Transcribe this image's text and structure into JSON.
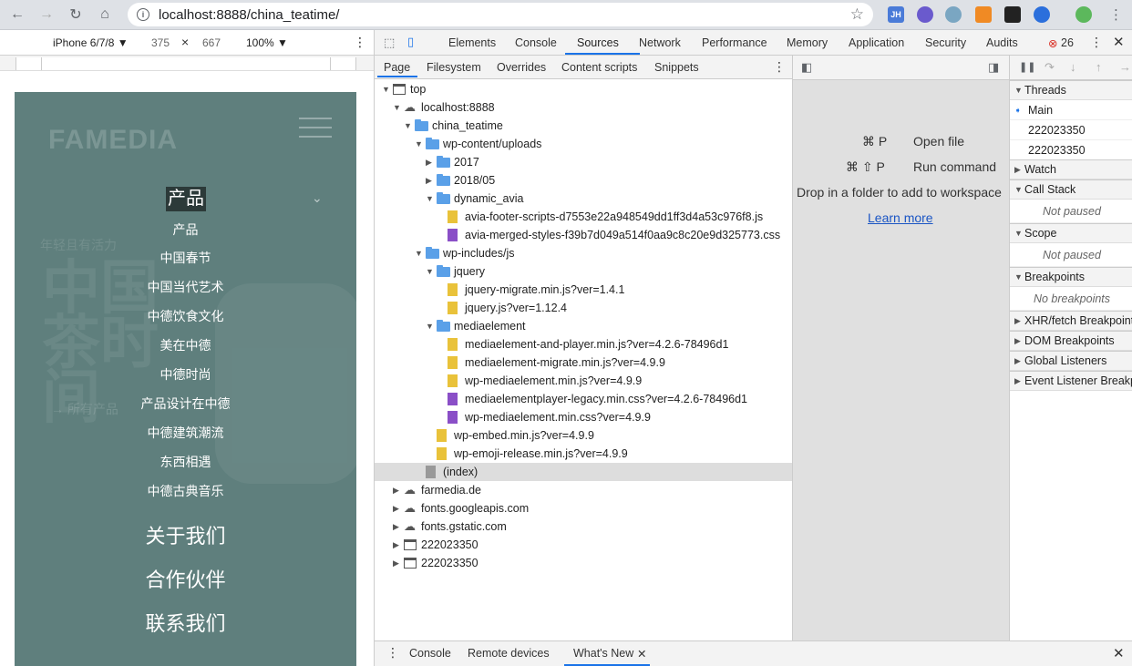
{
  "browser": {
    "url": "localhost:8888/china_teatime/",
    "ext_jh": "JH",
    "back_icon": "arrow-left-icon",
    "forward_icon": "arrow-right-icon",
    "reload_icon": "reload-icon",
    "home_icon": "home-icon"
  },
  "device": {
    "model": "iPhone 6/7/8 ▼",
    "width": "375",
    "times": "×",
    "height": "667",
    "zoom": "100% ▼"
  },
  "phone": {
    "logo": "FAMEDIA",
    "ghost_tagline": "年轻且有活力",
    "ghost_title": "中国茶时间",
    "ghost_link": "→ 所有产品",
    "menu_head": "产品",
    "menu_items": [
      "产品",
      "中国春节",
      "中国当代艺术",
      "中德饮食文化",
      "美在中德",
      "中德时尚",
      "产品设计在中德",
      "中德建筑潮流",
      "东西相遇",
      "中德古典音乐"
    ],
    "menu_big": [
      "关于我们",
      "合作伙伴",
      "联系我们"
    ]
  },
  "devtools": {
    "tabs": [
      "Elements",
      "Console",
      "Sources",
      "Network",
      "Performance",
      "Memory",
      "Application",
      "Security",
      "Audits"
    ],
    "error_count": "26",
    "sub_tabs": [
      "Page",
      "Filesystem",
      "Overrides",
      "Content scripts",
      "Snippets"
    ],
    "tree": [
      {
        "label": "top",
        "kind": "frame",
        "depth": 0,
        "open": true
      },
      {
        "label": "localhost:8888",
        "kind": "cloud",
        "depth": 1,
        "open": true
      },
      {
        "label": "china_teatime",
        "kind": "folder",
        "depth": 2,
        "open": true
      },
      {
        "label": "wp-content/uploads",
        "kind": "folder",
        "depth": 3,
        "open": true
      },
      {
        "label": "2017",
        "kind": "folder",
        "depth": 4,
        "open": false
      },
      {
        "label": "2018/05",
        "kind": "folder",
        "depth": 4,
        "open": false
      },
      {
        "label": "dynamic_avia",
        "kind": "folder",
        "depth": 4,
        "open": true
      },
      {
        "label": "avia-footer-scripts-d7553e22a948549dd1ff3d4a53c976f8.js",
        "kind": "js",
        "depth": 5
      },
      {
        "label": "avia-merged-styles-f39b7d049a514f0aa9c8c20e9d325773.css",
        "kind": "css",
        "depth": 5
      },
      {
        "label": "wp-includes/js",
        "kind": "folder",
        "depth": 3,
        "open": true
      },
      {
        "label": "jquery",
        "kind": "folder",
        "depth": 4,
        "open": true
      },
      {
        "label": "jquery-migrate.min.js?ver=1.4.1",
        "kind": "js",
        "depth": 5
      },
      {
        "label": "jquery.js?ver=1.12.4",
        "kind": "js",
        "depth": 5
      },
      {
        "label": "mediaelement",
        "kind": "folder",
        "depth": 4,
        "open": true
      },
      {
        "label": "mediaelement-and-player.min.js?ver=4.2.6-78496d1",
        "kind": "js",
        "depth": 5
      },
      {
        "label": "mediaelement-migrate.min.js?ver=4.9.9",
        "kind": "js",
        "depth": 5
      },
      {
        "label": "wp-mediaelement.min.js?ver=4.9.9",
        "kind": "js",
        "depth": 5
      },
      {
        "label": "mediaelementplayer-legacy.min.css?ver=4.2.6-78496d1",
        "kind": "css",
        "depth": 5
      },
      {
        "label": "wp-mediaelement.min.css?ver=4.9.9",
        "kind": "css",
        "depth": 5
      },
      {
        "label": "wp-embed.min.js?ver=4.9.9",
        "kind": "js",
        "depth": 4
      },
      {
        "label": "wp-emoji-release.min.js?ver=4.9.9",
        "kind": "js",
        "depth": 4
      },
      {
        "label": "(index)",
        "kind": "doc",
        "depth": 3,
        "selected": true
      },
      {
        "label": "farmedia.de",
        "kind": "cloud",
        "depth": 1,
        "open": false
      },
      {
        "label": "fonts.googleapis.com",
        "kind": "cloud",
        "depth": 1,
        "open": false
      },
      {
        "label": "fonts.gstatic.com",
        "kind": "cloud",
        "depth": 1,
        "open": false
      },
      {
        "label": "222023350",
        "kind": "frame",
        "depth": 1,
        "open": false
      },
      {
        "label": "222023350",
        "kind": "frame",
        "depth": 1,
        "open": false
      }
    ],
    "shortcuts": [
      {
        "keys": "⌘ P",
        "action": "Open file"
      },
      {
        "keys": "⌘ ⇧ P",
        "action": "Run command"
      }
    ],
    "drop_text": "Drop in a folder to add to workspace",
    "learn_more": "Learn more",
    "threads_title": "Threads",
    "threads": [
      "Main",
      "222023350",
      "222023350"
    ],
    "watch": "Watch",
    "call_stack": "Call Stack",
    "not_paused": "Not paused",
    "scope": "Scope",
    "breakpoints": "Breakpoints",
    "no_breakpoints": "No breakpoints",
    "xhr": "XHR/fetch Breakpoints",
    "dom": "DOM Breakpoints",
    "global": "Global Listeners",
    "event": "Event Listener Breakpoints",
    "drawer_tabs": [
      "Console",
      "Remote devices",
      "What's New"
    ]
  },
  "colors": {
    "accent": "#1a73e8",
    "phone_bg": "#5f7f7d",
    "js_file": "#e9c23a",
    "css_file": "#8a4fc7",
    "folder": "#5aa0e8"
  }
}
